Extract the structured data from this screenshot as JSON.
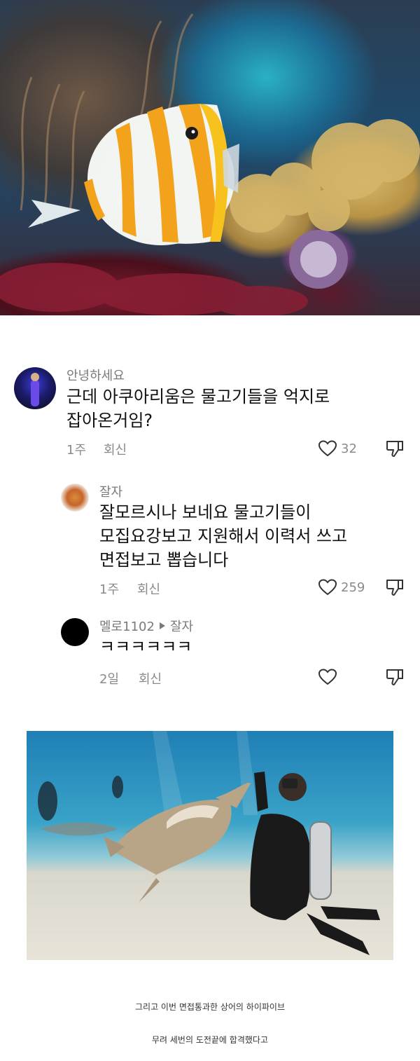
{
  "comments": [
    {
      "author": "안녕하세요",
      "lines": [
        "근데 아쿠아리움은 물고기들을 억지로",
        "잡아온거임?"
      ],
      "time": "1주",
      "reply_label": "회신",
      "likes": "32"
    },
    {
      "author": "잘자",
      "lines": [
        "잘모르시나 보네요 물고기들이",
        "모집요강보고 지원해서 이력서 쓰고",
        "면접보고 뽑습니다"
      ],
      "time": "1주",
      "reply_label": "회신",
      "likes": "259"
    },
    {
      "author": "멜로1102",
      "reply_to": "잘자",
      "lines": [
        "ㅋㅋㅋㅋㅋㅋ"
      ],
      "time": "2일",
      "reply_label": "회신",
      "likes": ""
    }
  ],
  "captions": [
    "그리고 이번 면접통과한 상어의 하이파이브",
    "무려 세번의 도전끝에 합격했다고"
  ],
  "icons": {
    "like": "heart-outline-icon",
    "dislike": "thumbs-down-outline-icon",
    "reply_arrow": "triangle-right-icon"
  },
  "colors": {
    "text_primary": "#111111",
    "text_secondary": "#8a8a8a",
    "background": "#ffffff"
  }
}
